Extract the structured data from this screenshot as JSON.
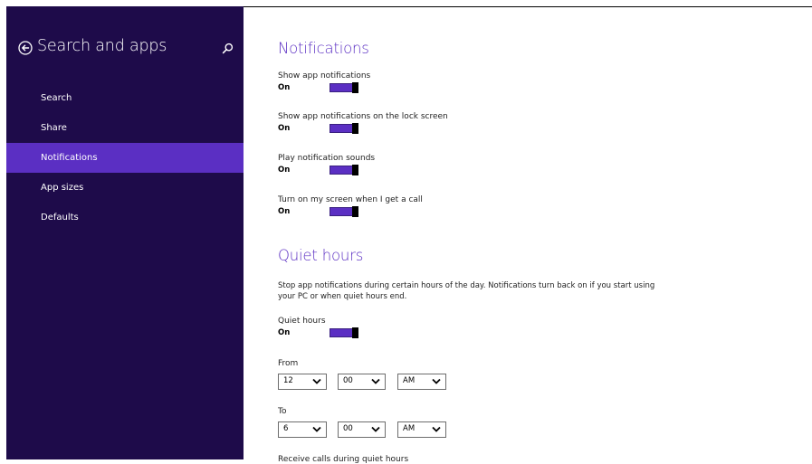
{
  "sidebar": {
    "title": "Search and apps",
    "items": [
      {
        "label": "Search"
      },
      {
        "label": "Share"
      },
      {
        "label": "Notifications"
      },
      {
        "label": "App sizes"
      },
      {
        "label": "Defaults"
      }
    ],
    "active_index": 2
  },
  "notifications": {
    "heading": "Notifications",
    "settings": [
      {
        "label": "Show app notifications",
        "state": "On"
      },
      {
        "label": "Show app notifications on the lock screen",
        "state": "On"
      },
      {
        "label": "Play notification sounds",
        "state": "On"
      },
      {
        "label": "Turn on my screen when I get a call",
        "state": "On"
      }
    ]
  },
  "quiet_hours": {
    "heading": "Quiet hours",
    "description": "Stop app notifications during certain hours of the day. Notifications turn back on if you start using your PC or when quiet hours end.",
    "toggle": {
      "label": "Quiet hours",
      "state": "On"
    },
    "from": {
      "label": "From",
      "hour": "12",
      "minute": "00",
      "ampm": "AM"
    },
    "to": {
      "label": "To",
      "hour": "6",
      "minute": "00",
      "ampm": "AM"
    },
    "next_label_cutoff": "Receive calls during quiet hours"
  },
  "colors": {
    "sidebar_bg": "#1e0b4a",
    "accent": "#5b2fc3"
  },
  "icons": {
    "back": "back-arrow-icon",
    "search": "search-icon",
    "dropdown": "chevron-down-icon"
  }
}
